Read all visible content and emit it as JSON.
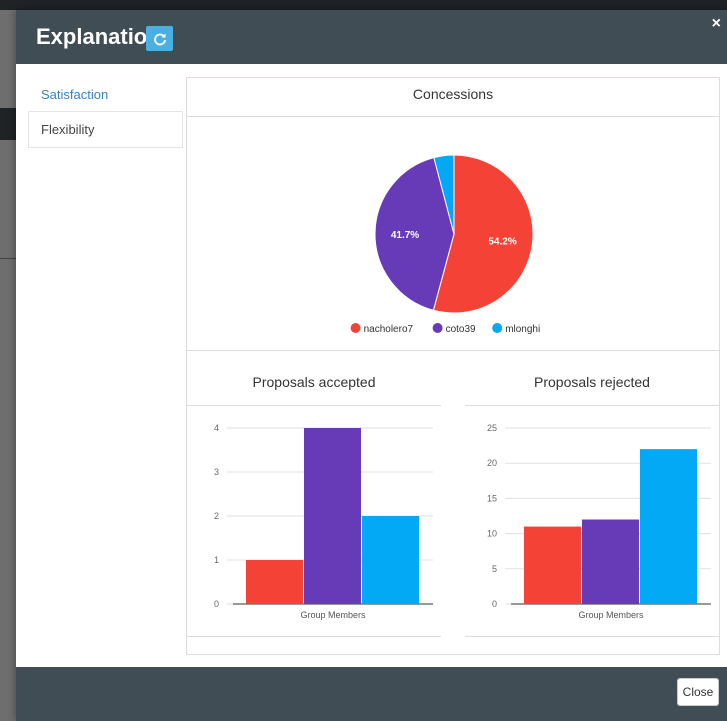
{
  "modal": {
    "title": "Explanations",
    "close_symbol": "×",
    "refresh_icon": "refresh-icon",
    "footer": {
      "close_label": "Close"
    }
  },
  "sidebar": {
    "items": [
      {
        "label": "Satisfaction",
        "active": true
      },
      {
        "label": "Flexibility",
        "active": false
      }
    ]
  },
  "colors": {
    "header": "#414d55",
    "accent_blue": "#3b7fc4",
    "refresh_button": "#4ab0e3",
    "series_red": "#f44336",
    "series_purple": "#673ab7",
    "series_blue": "#03a9f4"
  },
  "chart_data": [
    {
      "type": "pie",
      "title": "Concessions",
      "labels": [
        "nacholero7",
        "coto39",
        "mlonghi"
      ],
      "values": [
        54.2,
        41.7,
        4.1
      ],
      "value_labels": [
        "54.2%",
        "41.7%",
        ""
      ],
      "colors": [
        "#f44336",
        "#673ab7",
        "#03a9f4"
      ],
      "legend": "bottom"
    },
    {
      "type": "bar",
      "title": "Proposals accepted",
      "xlabel": "Group Members",
      "series": [
        {
          "name": "nacholero7",
          "values": [
            1
          ]
        },
        {
          "name": "coto39",
          "values": [
            4
          ]
        },
        {
          "name": "mlonghi",
          "values": [
            2
          ]
        }
      ],
      "ylim": [
        0,
        4
      ],
      "yticks": [
        0,
        1,
        2,
        3,
        4
      ],
      "grid": true
    },
    {
      "type": "bar",
      "title": "Proposals rejected",
      "xlabel": "Group Members",
      "series": [
        {
          "name": "nacholero7",
          "values": [
            11
          ]
        },
        {
          "name": "coto39",
          "values": [
            12
          ]
        },
        {
          "name": "mlonghi",
          "values": [
            22
          ]
        }
      ],
      "ylim": [
        0,
        25
      ],
      "yticks": [
        0,
        5,
        10,
        15,
        20,
        25
      ],
      "grid": true
    }
  ]
}
